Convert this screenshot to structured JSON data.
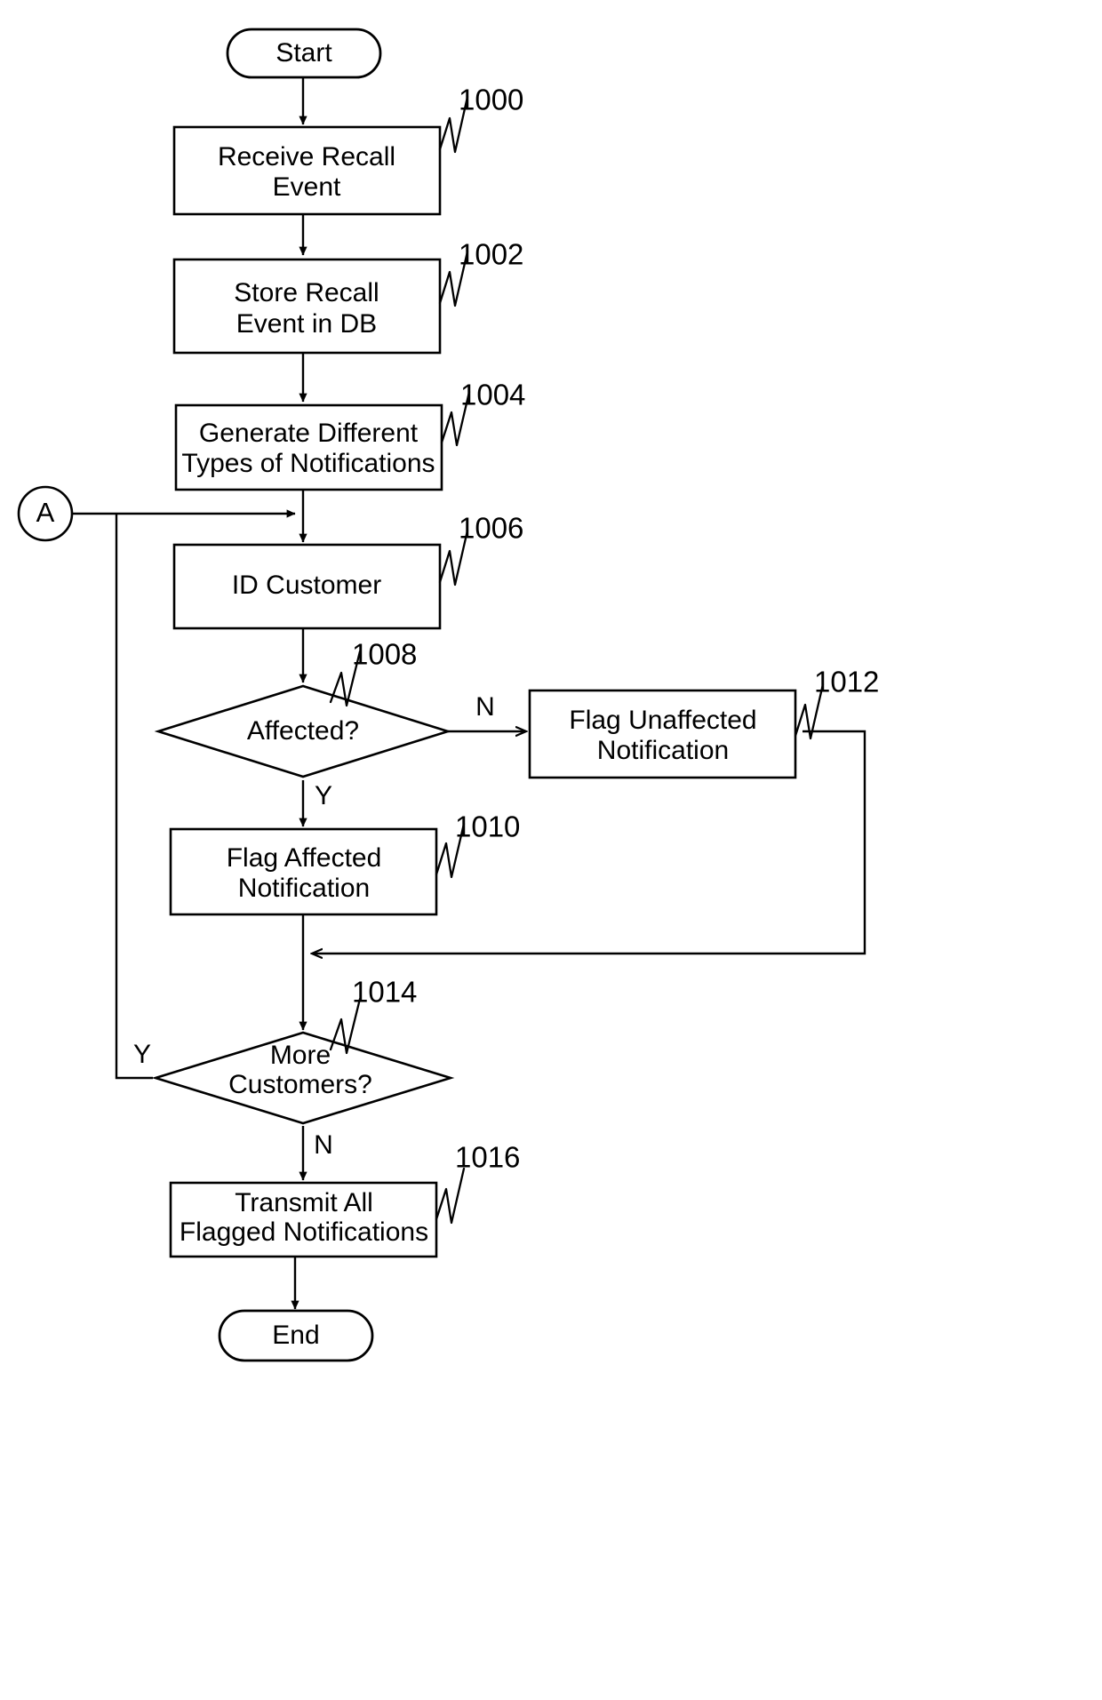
{
  "figure": {
    "type": "flowchart",
    "title": "Recall Event Notification Process Flowchart",
    "nodes": [
      {
        "id": "start",
        "shape": "terminator",
        "label": "Start"
      },
      {
        "id": "n1000",
        "shape": "process",
        "label_line1": "Receive Recall",
        "label_line2": "Event",
        "ref": "1000"
      },
      {
        "id": "n1002",
        "shape": "process",
        "label_line1": "Store Recall",
        "label_line2": "Event in DB",
        "ref": "1002"
      },
      {
        "id": "n1004",
        "shape": "process",
        "label_line1": "Generate Different",
        "label_line2": "Types of Notifications",
        "ref": "1004"
      },
      {
        "id": "n1006",
        "shape": "process",
        "label_line1": "ID Customer",
        "label_line2": "",
        "ref": "1006"
      },
      {
        "id": "n1008",
        "shape": "decision",
        "label_line1": "Affected?",
        "label_line2": "",
        "ref": "1008"
      },
      {
        "id": "n1012",
        "shape": "process",
        "label_line1": "Flag Unaffected",
        "label_line2": "Notification",
        "ref": "1012"
      },
      {
        "id": "n1010",
        "shape": "process",
        "label_line1": "Flag Affected",
        "label_line2": "Notification",
        "ref": "1010"
      },
      {
        "id": "n1014",
        "shape": "decision",
        "label_line1": "More",
        "label_line2": "Customers?",
        "ref": "1014"
      },
      {
        "id": "n1016",
        "shape": "process",
        "label_line1": "Transmit All",
        "label_line2": "Flagged Notifications",
        "ref": "1016"
      },
      {
        "id": "end",
        "shape": "terminator",
        "label": "End"
      },
      {
        "id": "connector_a",
        "shape": "connector",
        "label": "A"
      }
    ],
    "branch_labels": {
      "affected_no": "N",
      "affected_yes": "Y",
      "more_customers_yes": "Y",
      "more_customers_no": "N"
    },
    "reference_numerals": [
      "1000",
      "1002",
      "1004",
      "1006",
      "1008",
      "1010",
      "1012",
      "1014",
      "1016"
    ],
    "colors": {
      "stroke": "#000000",
      "fill": "#ffffff",
      "text": "#000000"
    }
  }
}
